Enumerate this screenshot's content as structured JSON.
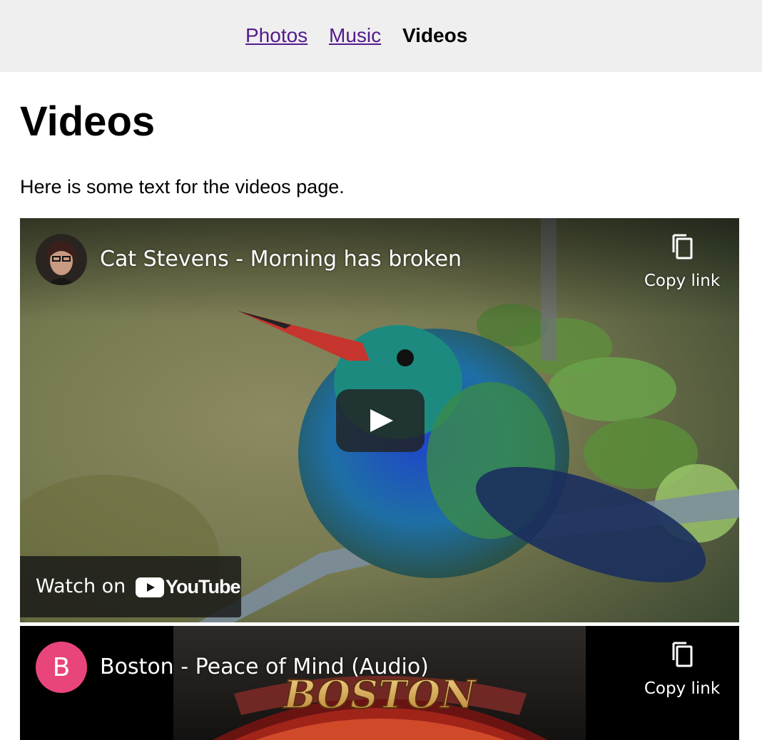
{
  "nav": {
    "items": [
      {
        "label": "Photos"
      },
      {
        "label": "Music"
      },
      {
        "label": "Videos"
      }
    ]
  },
  "page": {
    "title": "Videos",
    "intro": "Here is some text for the videos page."
  },
  "videos": [
    {
      "title": "Cat Stevens - Morning has broken",
      "copy_link_label": "Copy link",
      "watch_on_label": "Watch on",
      "youtube_wordmark": "YouTube",
      "play_icon": "play-icon",
      "copy_icon": "copy-icon"
    },
    {
      "title": "Boston - Peace of Mind (Audio)",
      "avatar_letter": "B",
      "copy_link_label": "Copy link",
      "thumbnail_text": "BOSTON",
      "copy_icon": "copy-icon"
    }
  ],
  "colors": {
    "link": "#551a8b",
    "nav_bg": "#efefef",
    "avatar_bg": "#e8457a",
    "youtube_red": "#ff0000"
  }
}
